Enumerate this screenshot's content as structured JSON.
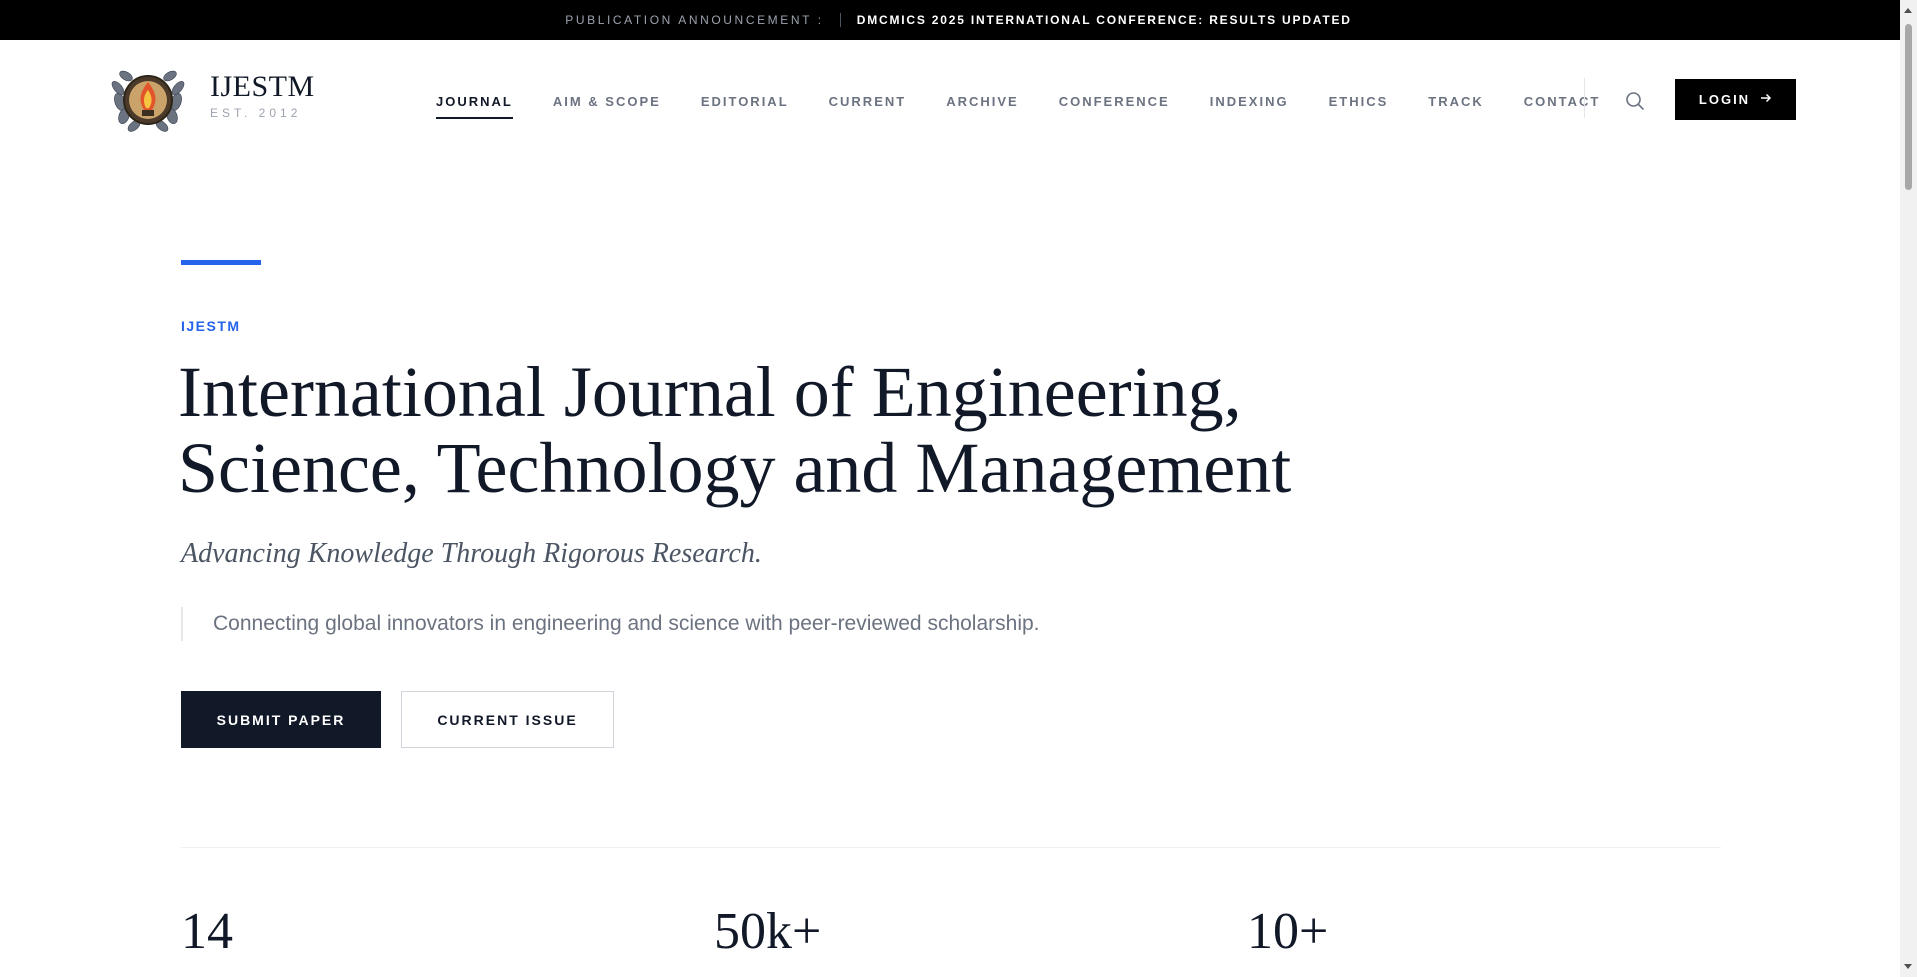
{
  "announcement": {
    "label": "PUBLICATION ANNOUNCEMENT :",
    "message": "DMCMICS 2025 INTERNATIONAL CONFERENCE: RESULTS UPDATED"
  },
  "brand": {
    "name": "IJESTM",
    "established": "EST. 2012",
    "logo_icon": "laurel-wreath-flame-emblem"
  },
  "nav": {
    "items": [
      {
        "label": "JOURNAL",
        "active": true
      },
      {
        "label": "AIM & SCOPE",
        "active": false
      },
      {
        "label": "EDITORIAL",
        "active": false
      },
      {
        "label": "CURRENT",
        "active": false
      },
      {
        "label": "ARCHIVE",
        "active": false
      },
      {
        "label": "CONFERENCE",
        "active": false
      },
      {
        "label": "INDEXING",
        "active": false
      },
      {
        "label": "ETHICS",
        "active": false
      },
      {
        "label": "TRACK",
        "active": false
      },
      {
        "label": "CONTACT",
        "active": false
      }
    ],
    "search_icon": "search-icon",
    "login_label": "LOGIN",
    "login_icon": "arrow-right-icon"
  },
  "hero": {
    "eyebrow": "IJESTM",
    "title_line1": "International Journal of Engineering,",
    "title_line2": "Science, Technology and Management",
    "subtitle": "Advancing Knowledge Through Rigorous Research.",
    "quote": "Connecting global innovators in engineering and science with peer-reviewed scholarship.",
    "primary_button": "SUBMIT PAPER",
    "secondary_button": "CURRENT ISSUE"
  },
  "stats": [
    {
      "value": "14",
      "label": ""
    },
    {
      "value": "50k+",
      "label": ""
    },
    {
      "value": "10+",
      "label": ""
    }
  ],
  "colors": {
    "accent": "#2563eb",
    "dark": "#111827",
    "announcement_bg": "#000000"
  }
}
